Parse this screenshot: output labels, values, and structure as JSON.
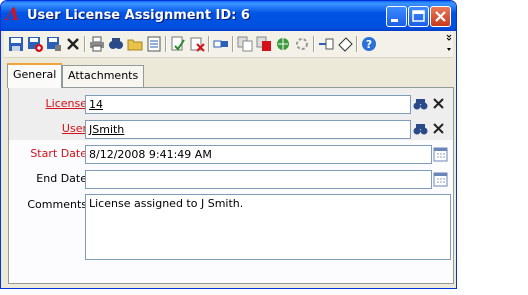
{
  "window": {
    "title": "User License Assignment ID: 6",
    "app_icon_glyph": "Λ",
    "accent_color": "#0054e3"
  },
  "toolbar": {
    "icons": [
      "save-icon",
      "save-add-icon",
      "save-close-icon",
      "delete-icon",
      "print-icon",
      "find-icon",
      "open-folder-icon",
      "list-icon",
      "spell-icon",
      "cancel-edit-icon",
      "link-icon",
      "copy-icon",
      "move-icon",
      "web-icon",
      "refresh-icon",
      "attach-icon",
      "tag-icon",
      "help-icon"
    ]
  },
  "tabs": [
    {
      "label": "General",
      "active": true
    },
    {
      "label": "Attachments",
      "active": false
    }
  ],
  "form": {
    "license": {
      "label": "License",
      "value": "14"
    },
    "user": {
      "label": "User",
      "value": "JSmith"
    },
    "start_date": {
      "label": "Start Date",
      "value": "8/12/2008 9:41:49 AM"
    },
    "end_date": {
      "label": "End Date",
      "value": ""
    },
    "comments": {
      "label": "Comments",
      "value": "License assigned to J Smith."
    }
  },
  "colors": {
    "required_label": "#d4101a",
    "tab_highlight": "#f2a33a"
  }
}
